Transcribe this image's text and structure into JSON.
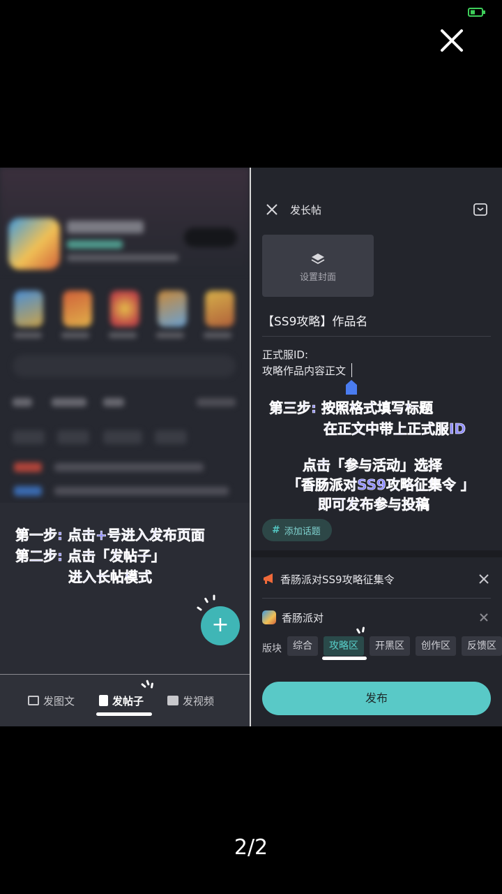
{
  "viewer": {
    "page_indicator": "2/2"
  },
  "left_panel": {
    "annotation": [
      "第一步: 点击+号进入发布页面",
      "第二步: 点击「发帖子」",
      "进入长帖模式"
    ],
    "fab_label": "+",
    "bottom_nav": [
      {
        "label": "发图文",
        "icon": "image-icon"
      },
      {
        "label": "发帖子",
        "icon": "document-icon",
        "active": true
      },
      {
        "label": "发视频",
        "icon": "video-icon"
      }
    ]
  },
  "right_panel": {
    "header_title": "发长帖",
    "cover_label": "设置封面",
    "post_title": "【SS9攻略】作品名",
    "body_line1": "正式服ID:",
    "body_line2": "攻略作品内容正文",
    "annotation": [
      "第三步: 按照格式填写标题",
      "在正文中带上正式服ID",
      "点击「参与活动」选择",
      "「香肠派对SS9攻略征集令 」",
      "即可发布参与投稿"
    ],
    "topic_button": "添加话题",
    "event_row": "香肠派对SS9攻略征集令",
    "game_row": "香肠派对",
    "category_label": "版块",
    "categories": [
      "综合",
      "攻略区",
      "开黑区",
      "创作区",
      "反馈区"
    ],
    "selected_category": "攻略区",
    "publish_button": "发布"
  },
  "colors": {
    "accent": "#59c9c7",
    "annotation": "#8f8dff",
    "background": "#23252c"
  }
}
